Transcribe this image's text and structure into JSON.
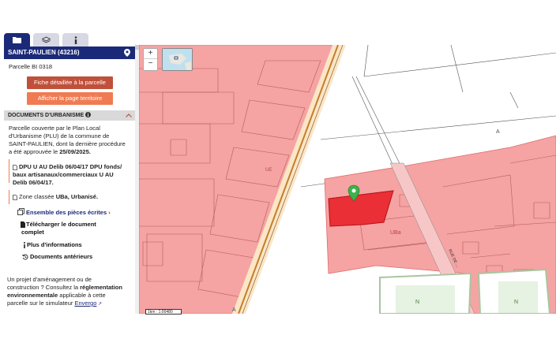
{
  "header": {
    "commune": "SAINT-PAULIEN (43216)"
  },
  "parcel": {
    "label": "Parcelle BI 0318"
  },
  "buttons": {
    "fiche": "Fiche détaillée à la parcelle",
    "territoire": "Afficher la page territoire"
  },
  "urbanisme": {
    "section_title": "DOCUMENTS D'URBANISME",
    "intro": [
      "Parcelle couverte par le Plan Local",
      "d'Urbanisme (PLU) de la commune de",
      "SAINT-PAULIEN, dont la dernière procédure"
    ],
    "intro_last_prefix": "a été approuvée le ",
    "intro_date": "25/09/2025.",
    "dpu": [
      "DPU U AU Delib 06/04/17 DPU fonds/",
      "baux artisanaux/commerciaux U AU",
      "Delib 06/04/17."
    ],
    "zone_prefix": "Zone classée ",
    "zone_value": "UBa, Urbanisé.",
    "links": {
      "pieces": "Ensemble des pièces écrites",
      "telecharger": [
        "Télécharger le document",
        "complet"
      ],
      "plus": "Plus d'informations",
      "anterieurs": "Documents antérieurs"
    }
  },
  "footer": {
    "lines": [
      "Un projet d'aménagement ou de",
      "construction ? Consultez la "
    ],
    "reglementation": "réglementation",
    "environnementale": "environnementale",
    "line3_suffix": " applicable à cette",
    "line4": "parcelle sur le simulateur ",
    "envergo": "Envergo"
  },
  "map": {
    "zone_labels": {
      "ube": "UE",
      "uba": "UBa",
      "a1": "A",
      "a2": "A",
      "n1": "N",
      "n2": "N"
    },
    "street": "RUE DE ...",
    "scale": "1km : 1:00480",
    "zoom_in": "+",
    "zoom_out": "−"
  },
  "colors": {
    "navy": "#1b2a78",
    "btn1": "#c0503a",
    "btn2": "#f07b52",
    "zone": "#f5a3a3",
    "selected": "#e8242b"
  }
}
